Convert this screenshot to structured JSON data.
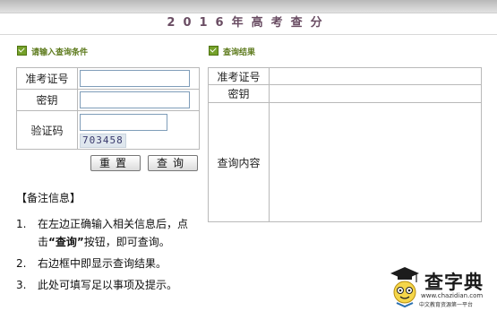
{
  "header": {
    "title": "2016年高考查分"
  },
  "left_panel": {
    "heading": "请输入查询条件",
    "fields": [
      {
        "label": "准考证号",
        "value": ""
      },
      {
        "label": "密钥",
        "value": ""
      },
      {
        "label": "验证码",
        "value": "",
        "captcha": "703458"
      }
    ],
    "reset_label": "重置",
    "query_label": "查询"
  },
  "right_panel": {
    "heading": "查询结果",
    "rows": [
      {
        "label": "准考证号",
        "value": ""
      },
      {
        "label": "密钥",
        "value": ""
      },
      {
        "label": "查询内容",
        "value": ""
      }
    ]
  },
  "notes": {
    "title": "【备注信息】",
    "items": [
      {
        "num": "1.",
        "before": "在左边正确输入相关信息后，点击",
        "bold": "“查询”",
        "after": "按钮，即可查询。"
      },
      {
        "num": "2.",
        "text": "右边框中即显示查询结果。"
      },
      {
        "num": "3.",
        "text": "此处可填写足以事项及提示。"
      }
    ]
  },
  "logo": {
    "name": "查字典",
    "url": "www.chazidian.com",
    "tagline": "中文教育资源第一平台"
  }
}
